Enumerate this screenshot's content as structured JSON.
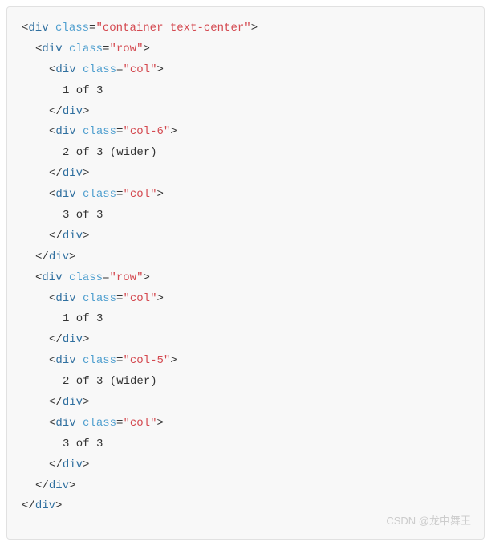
{
  "watermark": "CSDN @龙中舞王",
  "syntax": {
    "lt": "<",
    "gt": ">",
    "slash": "/",
    "eq": "=",
    "q": "\""
  },
  "tags": {
    "div": "div"
  },
  "attrs": {
    "class": "class"
  },
  "classes": {
    "container": "container text-center",
    "row": "row",
    "col": "col",
    "col6": "col-6",
    "col5": "col-5"
  },
  "content": {
    "c1": "1 of 3",
    "c2wider": "2 of 3 (wider)",
    "c3": "3 of 3"
  }
}
